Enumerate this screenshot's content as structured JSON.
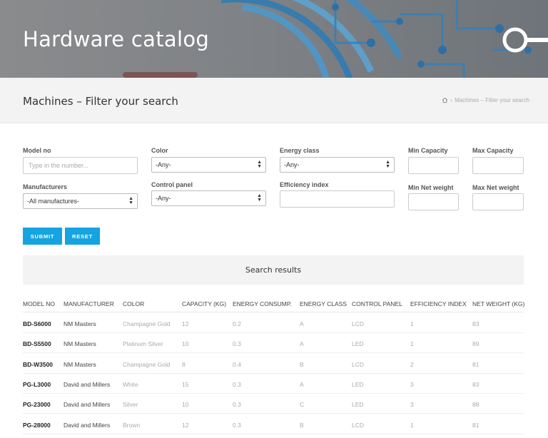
{
  "hero": {
    "title": "Hardware catalog"
  },
  "header": {
    "page_title": "Machines – Filter your search",
    "breadcrumb_current": "Machines – Filter your search",
    "home_icon": "home-icon"
  },
  "filters": {
    "model_no": {
      "label": "Model no",
      "placeholder": "Type in the number..."
    },
    "color": {
      "label": "Color",
      "value": "-Any-"
    },
    "energy_class": {
      "label": "Energy class",
      "value": "-Any-"
    },
    "min_capacity": {
      "label": "Min Capacity"
    },
    "max_capacity": {
      "label": "Max Capacity"
    },
    "manufacturers": {
      "label": "Manufacturers",
      "value": "-All manufactures-"
    },
    "control_panel": {
      "label": "Control panel",
      "value": "-Any-"
    },
    "efficiency_index": {
      "label": "Efficiency index"
    },
    "min_net_weight": {
      "label": "Min Net weight"
    },
    "max_net_weight": {
      "label": "Max Net weight"
    }
  },
  "buttons": {
    "submit": "SUBMIT",
    "reset": "RESET"
  },
  "results": {
    "title": "Search results",
    "columns": [
      "MODEL NO",
      "MANUFACTURER",
      "COLOR",
      "CAPACITY (KG)",
      "ENERGY CONSUMP.",
      "ENERGY CLASS",
      "CONTROL PANEL",
      "EFFICIENCY INDEX",
      "NET WEIGHT (KG)"
    ],
    "rows": [
      [
        "BD-S6000",
        "NM Masters",
        "Champagne Gold",
        "12",
        "0.2",
        "A",
        "LCD",
        "1",
        "83"
      ],
      [
        "BD-S5500",
        "NM Masters",
        "Platinum Silver",
        "10",
        "0.3",
        "A",
        "LED",
        "1",
        "89"
      ],
      [
        "BD-W3500",
        "NM Masters",
        "Champagne Gold",
        "8",
        "0.4",
        "B",
        "LCD",
        "2",
        "81"
      ],
      [
        "PG-L3000",
        "David and Millers",
        "White",
        "15",
        "0.3",
        "A",
        "LED",
        "3",
        "83"
      ],
      [
        "PG-23000",
        "David and Millers",
        "Silver",
        "10",
        "0.3",
        "C",
        "LED",
        "3",
        "88"
      ],
      [
        "PG-28000",
        "David and Millers",
        "Brown",
        "12",
        "0.3",
        "B",
        "LCD",
        "1",
        "81"
      ]
    ]
  },
  "colors": {
    "accent": "#14a4e1",
    "hero_bg": "#7d7e80",
    "bar_bg": "#f3f3f3"
  }
}
